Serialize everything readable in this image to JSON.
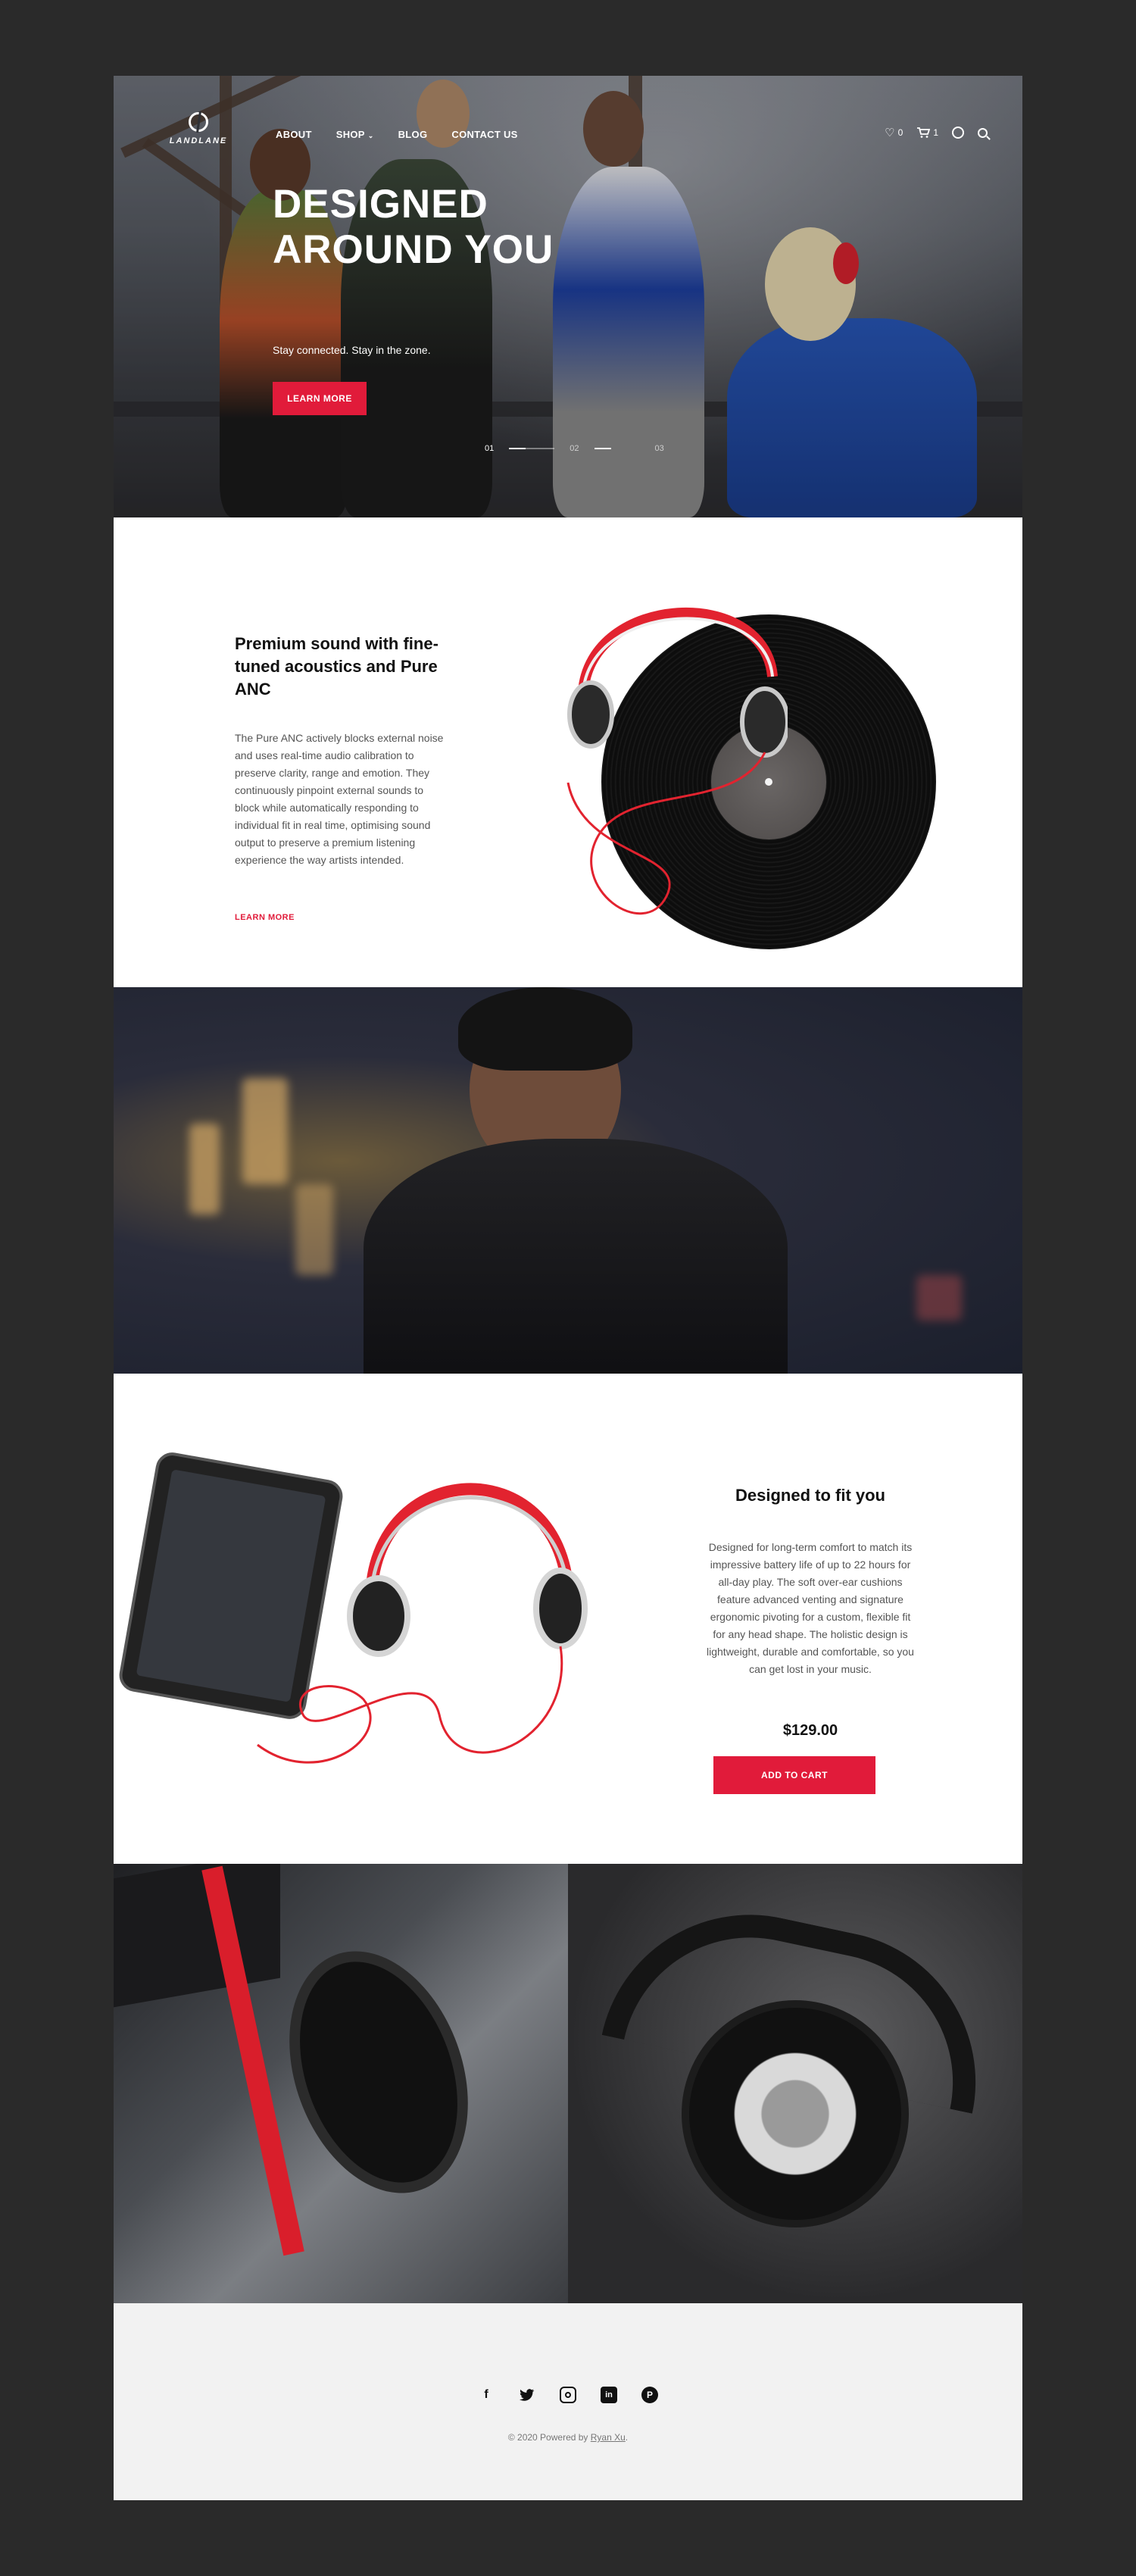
{
  "brand": {
    "name": "LANDLANE"
  },
  "nav": {
    "items": [
      {
        "label": "ABOUT"
      },
      {
        "label": "SHOP"
      },
      {
        "label": "BLOG"
      },
      {
        "label": "CONTACT US"
      }
    ],
    "wishlist_count": "0",
    "cart_count": "1"
  },
  "hero": {
    "title": "DESIGNED AROUND YOU",
    "subtitle": "Stay connected. Stay in the zone.",
    "button": "LEARN MORE",
    "slides": [
      "01",
      "02",
      "03"
    ]
  },
  "feature": {
    "title": "Premium sound with fine-tuned acoustics and Pure ANC",
    "body": "The Pure ANC actively blocks external noise and uses real-time audio calibration to preserve clarity, range and emotion. They continuously pinpoint external sounds to block while automatically responding to individual fit in real time, optimising sound output to preserve a premium listening experience the way artists intended.",
    "link": "LEARN MORE"
  },
  "product": {
    "title": "Designed to fit you",
    "body": "Designed for long-term comfort to match its impressive battery life of up to 22 hours for all-day play. The soft over-ear cushions feature advanced venting and signature ergonomic pivoting for a custom, flexible fit for any head shape. The holistic design is lightweight, durable and comfortable, so you can get lost in your music.",
    "price": "$129.00",
    "button": "ADD TO CART"
  },
  "footer": {
    "copyright": "© 2020 Powered by",
    "author": "Ryan Xu",
    "period": "."
  },
  "colors": {
    "accent": "#e11b3a",
    "background": "#2a2a2a",
    "footer": "#f2f2f2"
  }
}
